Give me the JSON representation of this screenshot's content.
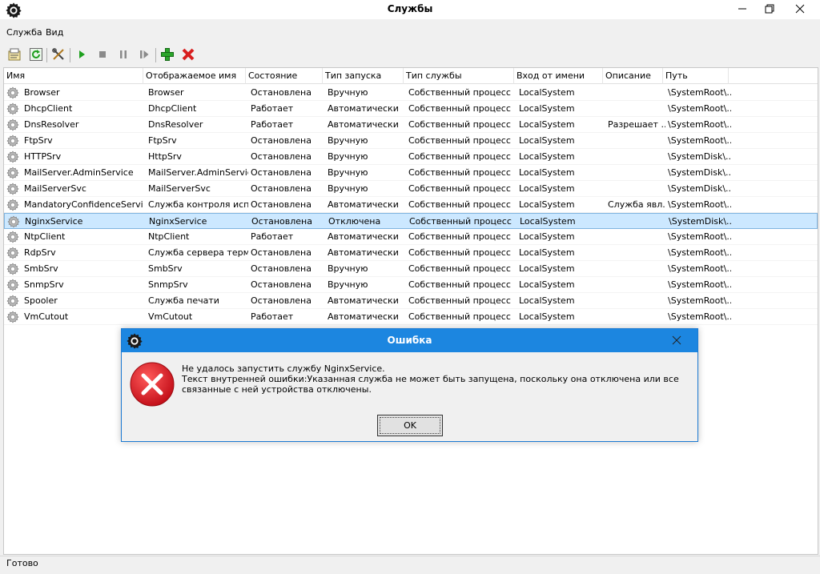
{
  "window": {
    "title": "Службы"
  },
  "menu": [
    "Служба",
    "Вид"
  ],
  "columns": [
    "Имя",
    "Отображаемое имя",
    "Состояние",
    "Тип запуска",
    "Тип службы",
    "Вход от имени",
    "Описание",
    "Путь"
  ],
  "rows": [
    [
      "Browser",
      "Browser",
      "Остановлена",
      "Вручную",
      "Собственный процесс",
      "LocalSystem",
      "",
      "\\SystemRoot\\..."
    ],
    [
      "DhcpClient",
      "DhcpClient",
      "Работает",
      "Автоматически",
      "Собственный процесс",
      "LocalSystem",
      "",
      "\\SystemRoot\\..."
    ],
    [
      "DnsResolver",
      "DnsResolver",
      "Работает",
      "Автоматически",
      "Собственный процесс",
      "LocalSystem",
      "Разрешает ...",
      "\\SystemRoot\\..."
    ],
    [
      "FtpSrv",
      "FtpSrv",
      "Остановлена",
      "Вручную",
      "Собственный процесс",
      "LocalSystem",
      "",
      "\\SystemRoot\\..."
    ],
    [
      "HTTPSrv",
      "HttpSrv",
      "Остановлена",
      "Вручную",
      "Собственный процесс",
      "LocalSystem",
      "",
      "\\SystemDisk\\..."
    ],
    [
      "MailServer.AdminService",
      "MailServer.AdminService",
      "Остановлена",
      "Вручную",
      "Собственный процесс",
      "LocalSystem",
      "",
      "\\SystemDisk\\..."
    ],
    [
      "MailServerSvc",
      "MailServerSvc",
      "Остановлена",
      "Вручную",
      "Собственный процесс",
      "LocalSystem",
      "",
      "\\SystemDisk\\..."
    ],
    [
      "MandatoryConfidenceService",
      "Служба контроля исп...",
      "Остановлена",
      "Автоматически",
      "Собственный процесс",
      "LocalSystem",
      "Служба явл...",
      "\\SystemRoot\\..."
    ],
    [
      "NginxService",
      "NginxService",
      "Остановлена",
      "Отключена",
      "Собственный процесс",
      "LocalSystem",
      "",
      "\\SystemDisk\\..."
    ],
    [
      "NtpClient",
      "NtpClient",
      "Работает",
      "Автоматически",
      "Собственный процесс",
      "LocalSystem",
      "",
      "\\SystemRoot\\..."
    ],
    [
      "RdpSrv",
      "Служба сервера терм...",
      "Остановлена",
      "Автоматически",
      "Собственный процесс",
      "LocalSystem",
      "",
      "\\SystemRoot\\..."
    ],
    [
      "SmbSrv",
      "SmbSrv",
      "Остановлена",
      "Вручную",
      "Собственный процесс",
      "LocalSystem",
      "",
      "\\SystemRoot\\..."
    ],
    [
      "SnmpSrv",
      "SnmpSrv",
      "Остановлена",
      "Вручную",
      "Собственный процесс",
      "LocalSystem",
      "",
      "\\SystemRoot\\..."
    ],
    [
      "Spooler",
      "Служба печати",
      "Остановлена",
      "Автоматически",
      "Собственный процесс",
      "LocalSystem",
      "",
      "\\SystemRoot\\..."
    ],
    [
      "VmCutout",
      "VmCutout",
      "Работает",
      "Автоматически",
      "Собственный процесс",
      "LocalSystem",
      "",
      "\\SystemRoot\\..."
    ]
  ],
  "selected_row": "NginxService",
  "status": {
    "text": "Готово"
  },
  "dialog": {
    "title": "Ошибка",
    "line1": "Не удалось запустить службу NginxService.",
    "line2": "Текст внутренней ошибки:Указанная служба не может быть запущена, поскольку она отключена или все связанные с ней устройства отключены.",
    "ok_label": "OK"
  },
  "colors": {
    "selection": "#cce8ff",
    "dialog_title_bar": "#1c86e0",
    "error_icon": "#e0202a",
    "start_icon": "#1ea01e",
    "add_icon": "#2aa52a",
    "delete_icon": "#d81e1e"
  },
  "icons": [
    "gear-app-icon",
    "properties-icon",
    "refresh-icon",
    "tools-icon",
    "start-icon",
    "stop-icon",
    "pause-icon",
    "resume-icon",
    "add-icon",
    "delete-icon",
    "service-gear-icon",
    "error-icon"
  ]
}
